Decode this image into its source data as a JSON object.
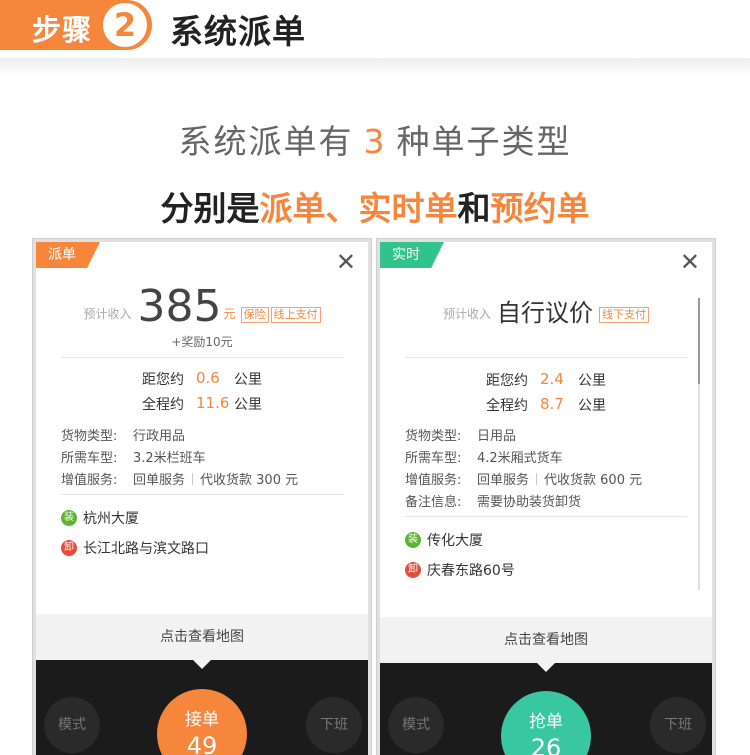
{
  "header": {
    "step_word": "步骤",
    "step_num": "2",
    "title": "系统派单"
  },
  "intro": {
    "line1_prefix": "系统派单有",
    "line1_count": "3",
    "line1_suffix": "种单子类型",
    "line2_a": "分别是",
    "line2_b": "派单、实时单",
    "line2_c": "和",
    "line2_d": "预约单"
  },
  "cards": [
    {
      "badge": "派单",
      "close": "✕",
      "income_label": "预计收入",
      "income_value": "385",
      "income_unit": "元",
      "tags": [
        "保险",
        "线上支付"
      ],
      "bonus": "+奖励10元",
      "distance_label": "距您约",
      "distance_value": "0.6",
      "distance_unit": "公里",
      "trip_label": "全程约",
      "trip_value": "11.6",
      "trip_unit": "公里",
      "info": [
        {
          "k": "货物类型:",
          "v": "行政用品"
        },
        {
          "k": "所需车型:",
          "v": "3.2米栏班车"
        },
        {
          "k": "增值服务:",
          "v": "回单服务",
          "v2": "代收货款 300 元"
        }
      ],
      "load_icon": "装",
      "load_addr": "杭州大厦",
      "unload_icon": "卸",
      "unload_addr": "长江北路与滨文路口",
      "map_label": "点击查看地图",
      "left_btn": "模式",
      "right_btn": "下班",
      "main_label": "接单",
      "main_count": "49",
      "accent": "#f5863c"
    },
    {
      "badge": "实时",
      "close": "✕",
      "income_label": "预计收入",
      "income_value": "自行议价",
      "tags": [
        "线下支付"
      ],
      "distance_label": "距您约",
      "distance_value": "2.4",
      "distance_unit": "公里",
      "trip_label": "全程约",
      "trip_value": "8.7",
      "trip_unit": "公里",
      "info": [
        {
          "k": "货物类型:",
          "v": "日用品"
        },
        {
          "k": "所需车型:",
          "v": "4.2米厢式货车"
        },
        {
          "k": "增值服务:",
          "v": "回单服务",
          "v2": "代收货款 600 元"
        },
        {
          "k": "备注信息:",
          "v": "需要协助装货卸货"
        }
      ],
      "load_icon": "装",
      "load_addr": "传化大厦",
      "unload_icon": "卸",
      "unload_addr": "庆春东路60号",
      "map_label": "点击查看地图",
      "left_btn": "模式",
      "right_btn": "下班",
      "main_label": "抢单",
      "main_count": "26",
      "accent": "#32c28c"
    }
  ]
}
